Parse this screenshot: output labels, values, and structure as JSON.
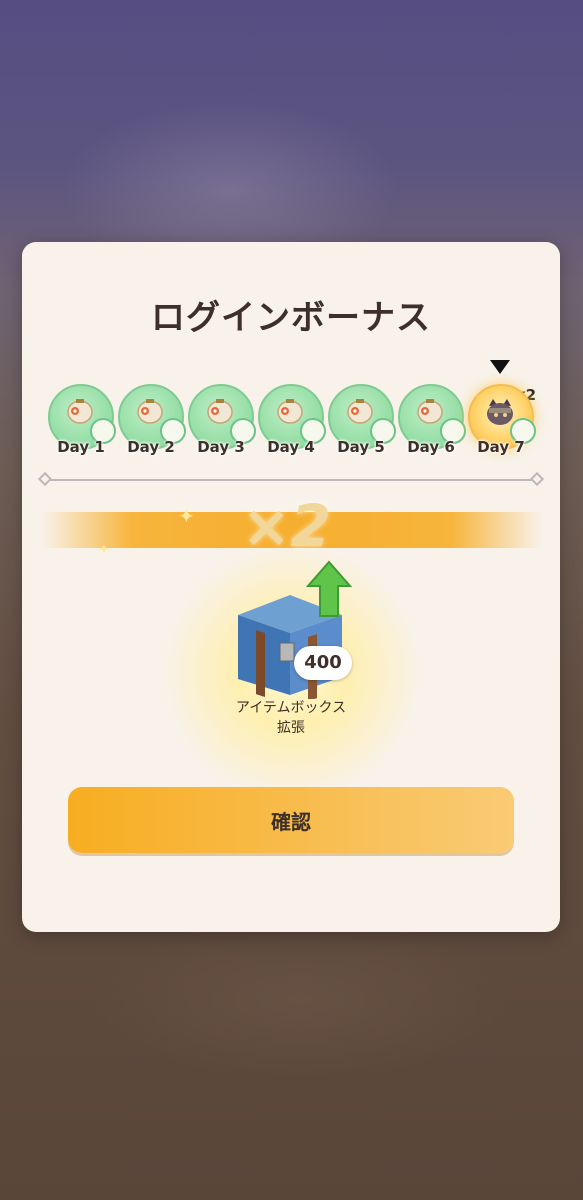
{
  "modal": {
    "title": "ログインボーナス"
  },
  "days": [
    {
      "label": "Day 1",
      "state": "claimed"
    },
    {
      "label": "Day 2",
      "state": "claimed"
    },
    {
      "label": "Day 3",
      "state": "claimed"
    },
    {
      "label": "Day 4",
      "state": "claimed"
    },
    {
      "label": "Day 5",
      "state": "claimed"
    },
    {
      "label": "Day 6",
      "state": "claimed"
    },
    {
      "label": "Day 7",
      "state": "active",
      "multiplier": "x2"
    }
  ],
  "reward": {
    "multiplier_banner": "×2",
    "count": "400",
    "name_line1": "アイテムボックス",
    "name_line2": "拡張"
  },
  "confirm_label": "確認",
  "colors": {
    "accent": "#f7ad21",
    "day_claimed": "#9be0aa",
    "day_active": "#ffd36b"
  }
}
